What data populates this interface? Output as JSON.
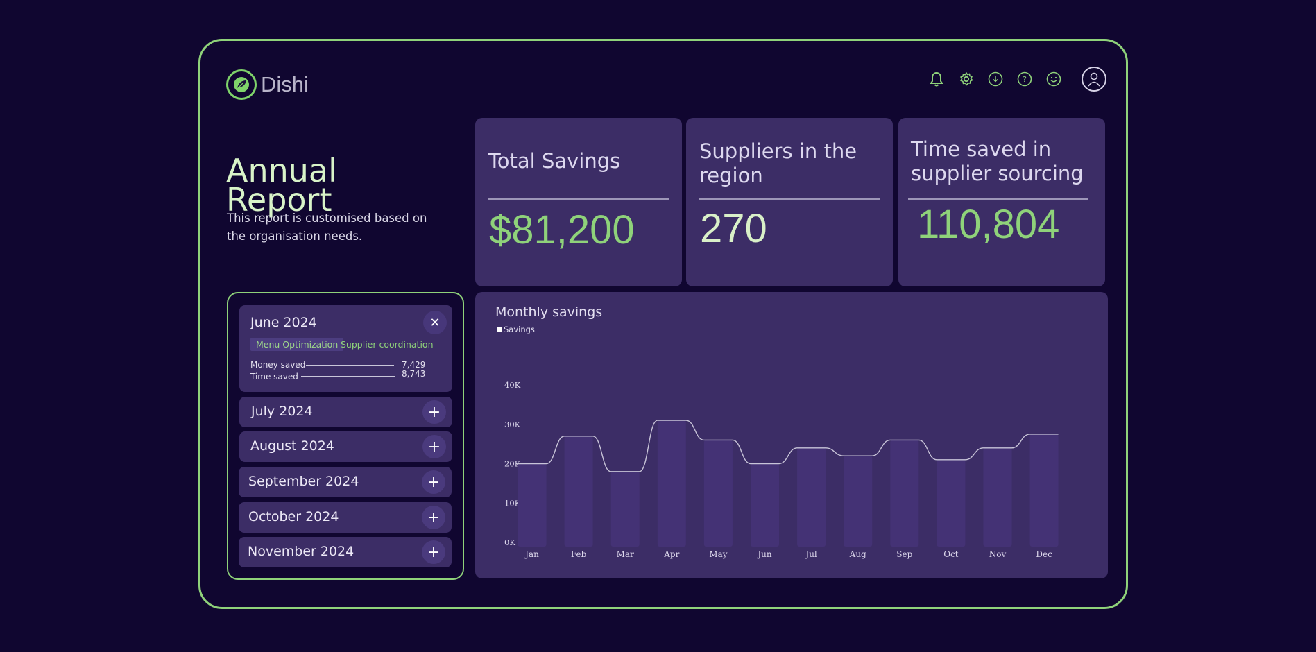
{
  "app": {
    "name": "Dishi"
  },
  "header": {
    "title_line1": "Annual",
    "title_line2": "Report",
    "subtitle": "This report is customised based on the organisation needs."
  },
  "toolbar": {
    "icons": [
      "bell-icon",
      "gear-icon",
      "download-icon",
      "help-icon",
      "smiley-icon",
      "user-avatar"
    ]
  },
  "stats": [
    {
      "label": "Total Savings",
      "value": "$81,200",
      "color": "#8fd27a"
    },
    {
      "label": "Suppliers in the region",
      "value": "270",
      "color": "#d9f0c8"
    },
    {
      "label": "Time saved in supplier sourcing",
      "value": "110,804",
      "color": "#8fd27a"
    }
  ],
  "accordion": {
    "open": {
      "month": "June 2024",
      "close_icon": "✕",
      "tags": [
        "Menu Optimization",
        "Supplier coordination"
      ],
      "metrics": [
        {
          "label": "Money saved",
          "value": "7,429"
        },
        {
          "label": "Time saved",
          "value": "8,743"
        }
      ]
    },
    "items": [
      {
        "month": "July 2024",
        "icon": "+"
      },
      {
        "month": "August 2024",
        "icon": "+"
      },
      {
        "month": "September 2024",
        "icon": "+"
      },
      {
        "month": "October 2024",
        "icon": "+"
      },
      {
        "month": "November 2024",
        "icon": "+"
      }
    ]
  },
  "chart_data": {
    "type": "bar",
    "title": "Monthly savings",
    "xlabel": "",
    "ylabel": "",
    "legend": "top-left",
    "grid": false,
    "categories": [
      "Jan",
      "Feb",
      "Mar",
      "Apr",
      "May",
      "Jun",
      "Jul",
      "Aug",
      "Sep",
      "Oct",
      "Nov",
      "Dec"
    ],
    "y_ticks": [
      "0K",
      "10K",
      "20K",
      "30K",
      "40K"
    ],
    "ylim": [
      0,
      40000
    ],
    "series": [
      {
        "name": "Savings",
        "values": [
          20000,
          27000,
          18000,
          31000,
          26000,
          20000,
          24000,
          22000,
          26000,
          21000,
          24000,
          27500
        ],
        "color": "#443275"
      }
    ],
    "line_color": "#c8c4d8"
  }
}
